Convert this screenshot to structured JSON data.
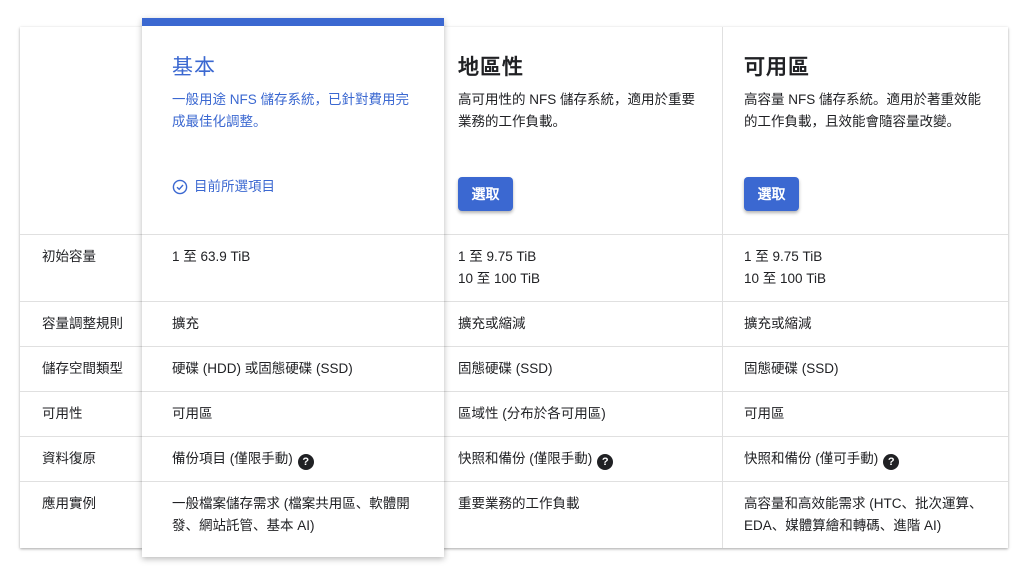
{
  "tiers": [
    {
      "name": "基本",
      "description": "一般用途 NFS 儲存系統，已針對費用完成最佳化調整。",
      "status": "目前所選項目",
      "cells": [
        "1 至 63.9 TiB",
        "擴充",
        "硬碟 (HDD) 或固態硬碟 (SSD)",
        "可用區",
        "備份項目 (僅限手動)",
        "一般檔案儲存需求 (檔案共用區、軟體開發、網站託管、基本 AI)"
      ]
    },
    {
      "name": "地區性",
      "description": "高可用性的 NFS 儲存系統，適用於重要業務的工作負載。",
      "button": "選取",
      "cells": [
        "1 至 9.75 TiB\n10 至 100 TiB",
        "擴充或縮減",
        "固態硬碟 (SSD)",
        "區域性 (分布於各可用區)",
        "快照和備份 (僅限手動)",
        "重要業務的工作負載"
      ]
    },
    {
      "name": "可用區",
      "description": "高容量 NFS 儲存系統。適用於著重效能的工作負載，且效能會隨容量改變。",
      "button": "選取",
      "cells": [
        "1 至 9.75 TiB\n10 至 100 TiB",
        "擴充或縮減",
        "固態硬碟 (SSD)",
        "可用區",
        "快照和備份 (僅可手動)",
        "高容量和高效能需求 (HTC、批次運算、EDA、媒體算繪和轉碼、進階 AI)"
      ]
    }
  ],
  "row_labels": [
    "初始容量",
    "容量調整規則",
    "儲存空間類型",
    "可用性",
    "資料復原",
    "應用實例"
  ],
  "help_icon": "question-circle-icon",
  "check_icon": "check-circle-icon",
  "colors": {
    "accent": "#3b68d1",
    "text": "#202124",
    "divider": "#e0e0e0"
  }
}
